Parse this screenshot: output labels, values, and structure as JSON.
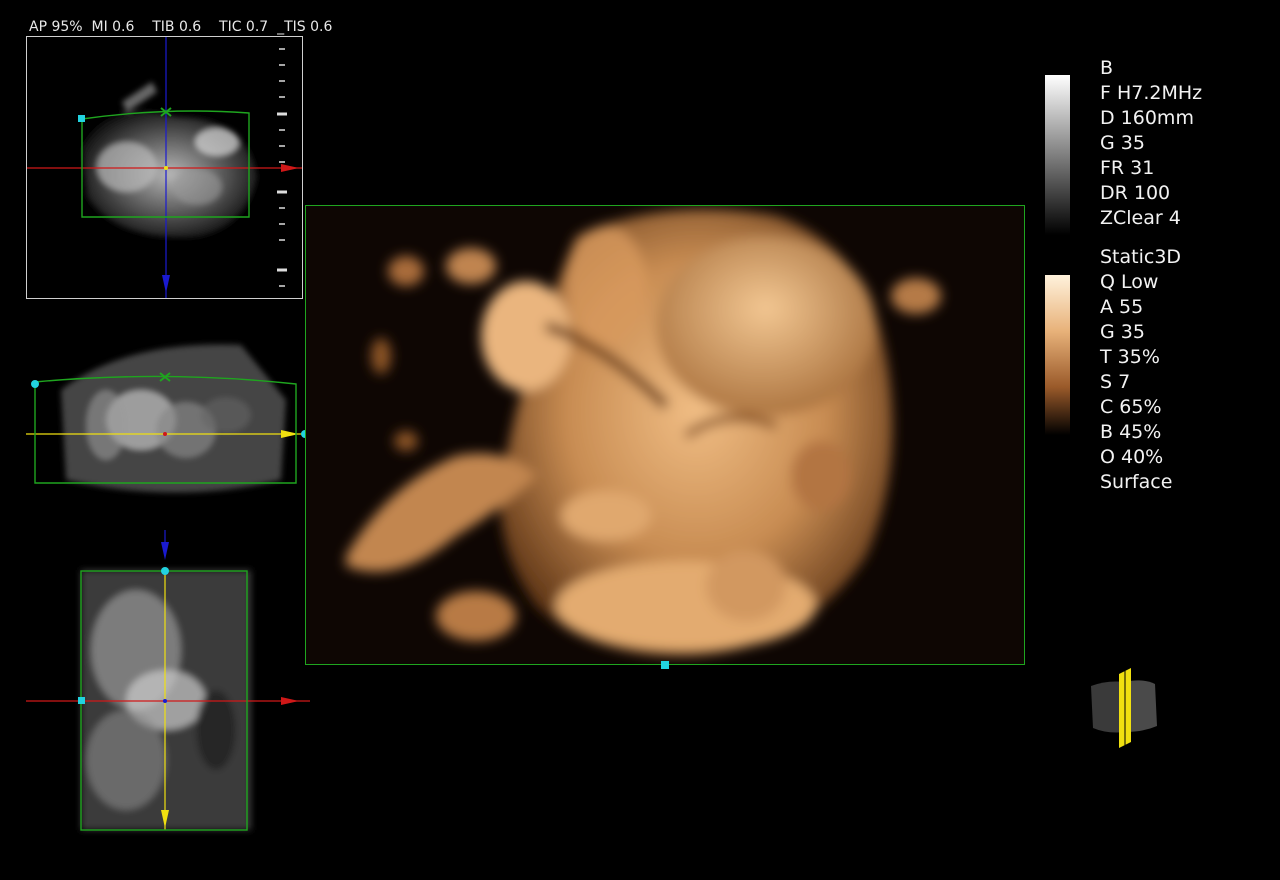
{
  "header": {
    "readout": "AP 95%  MI 0.6    TIB 0.6    TIC 0.7  _TIS 0.6"
  },
  "bmode": {
    "items": [
      "B",
      "F H7.2MHz",
      "D 160mm",
      "G 35",
      "FR 31",
      "DR 100",
      "ZClear 4"
    ]
  },
  "render": {
    "items": [
      "Static3D",
      "Q Low",
      "A 55",
      "G 35",
      "T 35%",
      "S 7",
      "C 65%",
      "B 45%",
      "O 40%",
      "Surface"
    ]
  },
  "colors": {
    "roi_green": "#1fa51f",
    "marker_cyan": "#22d3e0",
    "axis_red": "#d01818",
    "axis_blue": "#1a1ad0",
    "axis_yellow": "#f0e010",
    "render_tone": "#e2a56a"
  },
  "icons": {
    "orientation": "orientation-cube-icon"
  }
}
